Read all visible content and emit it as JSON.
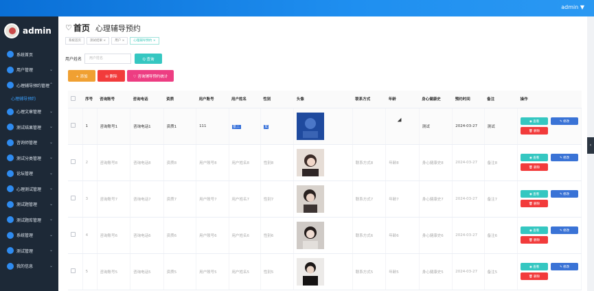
{
  "topbar": {
    "user": "admin ▼"
  },
  "brand": {
    "name": "admin"
  },
  "sidebar": {
    "items": [
      {
        "label": "系统首页",
        "arrow": ""
      },
      {
        "label": "用户管理",
        "arrow": "⌄"
      },
      {
        "label": "心理辅导预约管理",
        "arrow": "⌃"
      },
      {
        "label": "心理辅导预约",
        "sub": true
      },
      {
        "label": "心理文章管理",
        "arrow": "⌄"
      },
      {
        "label": "测试结果管理",
        "arrow": "⌄"
      },
      {
        "label": "咨询师管理",
        "arrow": "⌄"
      },
      {
        "label": "测试分类管理",
        "arrow": "⌄"
      },
      {
        "label": "论坛管理",
        "arrow": "⌄"
      },
      {
        "label": "心理测试管理",
        "arrow": "⌄"
      },
      {
        "label": "测试题管理",
        "arrow": "⌄"
      },
      {
        "label": "测试题库管理",
        "arrow": "⌄"
      },
      {
        "label": "系统管理",
        "arrow": "⌄"
      },
      {
        "label": "测试管理",
        "arrow": "⌄"
      },
      {
        "label": "我的信息",
        "arrow": "⌄"
      }
    ]
  },
  "header": {
    "home": "首页",
    "crumb": "心理辅导预约"
  },
  "tags": [
    "系统首页",
    "测试结果 ×",
    "用户 ×",
    "心理辅导预约 ×"
  ],
  "search": {
    "label": "用户姓名",
    "placeholder": "用户姓名",
    "button": "Q 查询"
  },
  "actions": {
    "add": "+ 添加",
    "delete": "⊟ 删除",
    "stat": "♡ 咨询辅导预约统计"
  },
  "table": {
    "headers": [
      "",
      "序号",
      "咨询账号",
      "咨询电话",
      "资质",
      "用户账号",
      "用户姓名",
      "性别",
      "头像",
      "联系方式",
      "年龄",
      "身心健康史",
      "预约时间",
      "备注",
      "操作"
    ],
    "rows": [
      [
        "",
        "1",
        "咨询账号1",
        "咨询电话1",
        "资质1",
        "111",
        "张三",
        "女",
        "",
        "",
        "",
        "测试",
        "2024-03-27",
        "测试",
        ""
      ],
      [
        "",
        "2",
        "咨询账号8",
        "咨询电话8",
        "资质8",
        "用户账号8",
        "用户姓名8",
        "性别8",
        "",
        "联系方式8",
        "年龄8",
        "身心健康史8",
        "2024-03-27",
        "备注8",
        ""
      ],
      [
        "",
        "3",
        "咨询账号7",
        "咨询电话7",
        "资质7",
        "用户账号7",
        "用户姓名7",
        "性别7",
        "",
        "联系方式7",
        "年龄7",
        "身心健康史7",
        "2024-03-27",
        "备注7",
        ""
      ],
      [
        "",
        "4",
        "咨询账号6",
        "咨询电话6",
        "资质6",
        "用户账号6",
        "用户姓名6",
        "性别6",
        "",
        "联系方式6",
        "年龄6",
        "身心健康史6",
        "2024-03-27",
        "备注6",
        ""
      ],
      [
        "",
        "5",
        "咨询账号5",
        "咨询电话5",
        "资质5",
        "用户账号5",
        "用户姓名5",
        "性别5",
        "",
        "联系方式5",
        "年龄5",
        "身心健康史5",
        "2024-03-27",
        "备注5",
        ""
      ]
    ],
    "op": {
      "view": "◉ 查看",
      "edit": "✎ 修改",
      "remove": "🗑 删除"
    }
  },
  "colors": {
    "primary": "#1f8ff0",
    "sidebar": "#1d2937",
    "teal": "#35c7c1",
    "red": "#f23b3b",
    "orange": "#f0a032",
    "pink": "#ed3d82"
  }
}
